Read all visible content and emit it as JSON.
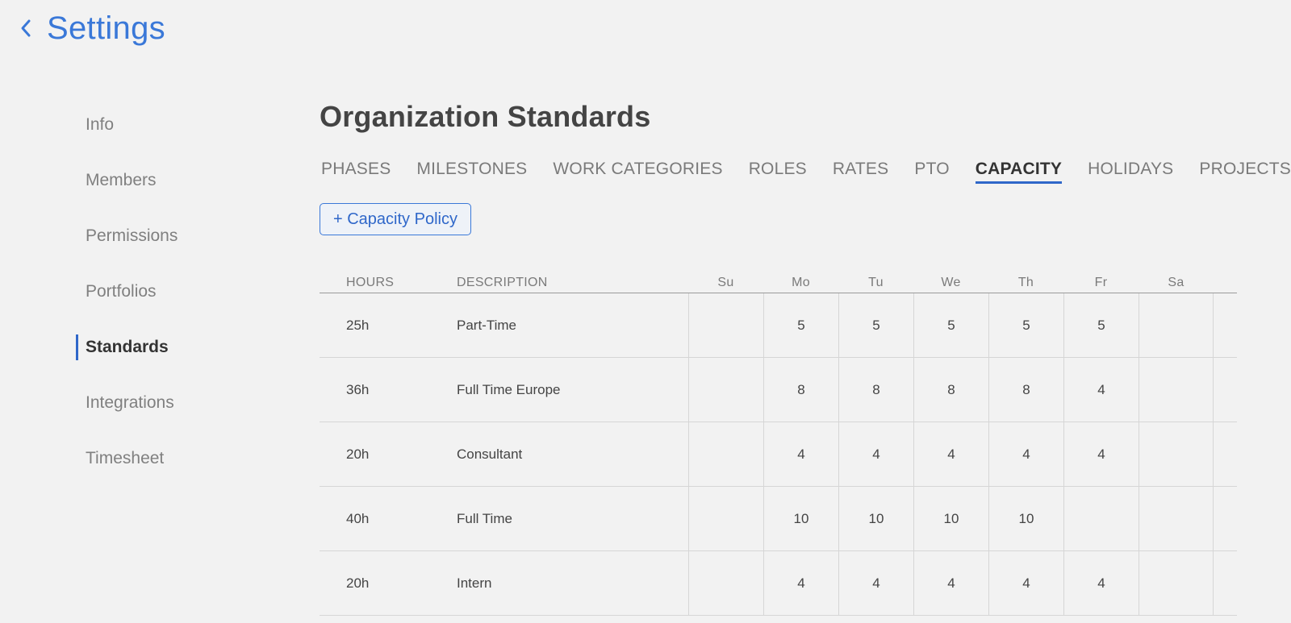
{
  "header": {
    "title": "Settings",
    "back_icon": "chevron-left-icon"
  },
  "sidebar": {
    "items": [
      {
        "label": "Info",
        "active": false
      },
      {
        "label": "Members",
        "active": false
      },
      {
        "label": "Permissions",
        "active": false
      },
      {
        "label": "Portfolios",
        "active": false
      },
      {
        "label": "Standards",
        "active": true
      },
      {
        "label": "Integrations",
        "active": false
      },
      {
        "label": "Timesheet",
        "active": false
      }
    ]
  },
  "main": {
    "title": "Organization Standards",
    "tabs": [
      {
        "label": "PHASES",
        "active": false
      },
      {
        "label": "MILESTONES",
        "active": false
      },
      {
        "label": "WORK CATEGORIES",
        "active": false
      },
      {
        "label": "ROLES",
        "active": false
      },
      {
        "label": "RATES",
        "active": false
      },
      {
        "label": "PTO",
        "active": false
      },
      {
        "label": "CAPACITY",
        "active": true
      },
      {
        "label": "HOLIDAYS",
        "active": false
      },
      {
        "label": "PROJECTS",
        "active": false
      }
    ],
    "add_button_label": "+ Capacity Policy"
  },
  "table": {
    "headers": {
      "hours": "HOURS",
      "description": "DESCRIPTION",
      "days": [
        "Su",
        "Mo",
        "Tu",
        "We",
        "Th",
        "Fr",
        "Sa"
      ]
    },
    "rows": [
      {
        "hours": "25h",
        "description": "Part-Time",
        "days": [
          "",
          "5",
          "5",
          "5",
          "5",
          "5",
          ""
        ]
      },
      {
        "hours": "36h",
        "description": "Full Time Europe",
        "days": [
          "",
          "8",
          "8",
          "8",
          "8",
          "4",
          ""
        ]
      },
      {
        "hours": "20h",
        "description": "Consultant",
        "days": [
          "",
          "4",
          "4",
          "4",
          "4",
          "4",
          ""
        ]
      },
      {
        "hours": "40h",
        "description": "Full Time",
        "days": [
          "",
          "10",
          "10",
          "10",
          "10",
          "",
          ""
        ]
      },
      {
        "hours": "20h",
        "description": "Intern",
        "days": [
          "",
          "4",
          "4",
          "4",
          "4",
          "4",
          ""
        ]
      }
    ]
  },
  "colors": {
    "accent": "#3a78d8",
    "active_indicator": "#2f67c9",
    "background": "#f2f2f2"
  }
}
